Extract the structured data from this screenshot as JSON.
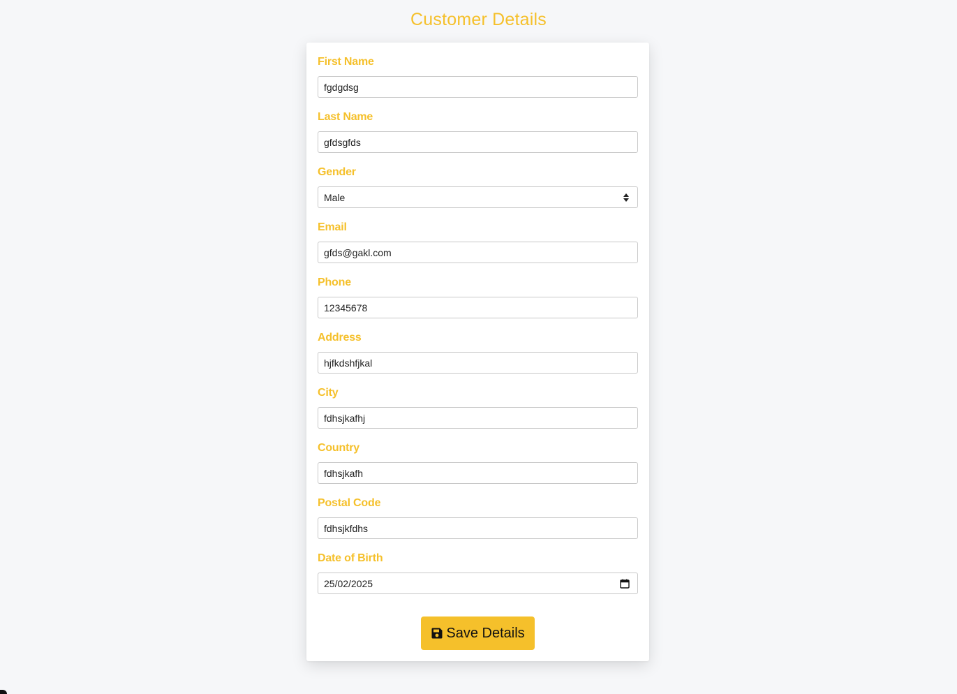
{
  "page": {
    "title": "Customer Details"
  },
  "colors": {
    "accent": "#f5c02b",
    "background": "#f6f7f9",
    "card": "#ffffff"
  },
  "form": {
    "fields": [
      {
        "label": "First Name",
        "value": "fgdgdsg",
        "type": "text"
      },
      {
        "label": "Last Name",
        "value": "gfdsgfds",
        "type": "text"
      },
      {
        "label": "Gender",
        "value": "Male",
        "type": "select"
      },
      {
        "label": "Email",
        "value": "gfds@gakl.com",
        "type": "email"
      },
      {
        "label": "Phone",
        "value": "12345678",
        "type": "tel"
      },
      {
        "label": "Address",
        "value": "hjfkdshfjkal",
        "type": "text"
      },
      {
        "label": "City",
        "value": "fdhsjkafhj",
        "type": "text"
      },
      {
        "label": "Country",
        "value": "fdhsjkafh",
        "type": "text"
      },
      {
        "label": "Postal Code",
        "value": "fdhsjkfdhs",
        "type": "text"
      },
      {
        "label": "Date of Birth",
        "value": "25/02/2025",
        "type": "date"
      }
    ],
    "save_label": "Save Details",
    "icons": {
      "select": "select-arrows-icon",
      "date": "calendar-icon",
      "save": "floppy-disk-icon"
    }
  }
}
